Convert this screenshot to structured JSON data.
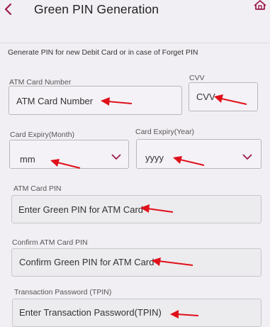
{
  "header": {
    "title": "Green PIN Generation",
    "back_icon": "chevron-left-icon",
    "home_icon": "home-icon"
  },
  "form": {
    "intro": "Generate PIN for new Debit Card or in case of Forget PIN",
    "card_number": {
      "label": "ATM Card Number",
      "placeholder": "ATM Card Number"
    },
    "cvv": {
      "label": "CVV",
      "placeholder": "CVV"
    },
    "expiry_month": {
      "label": "Card Expiry(Month)",
      "value": "mm"
    },
    "expiry_year": {
      "label": "Card Expiry(Year)",
      "value": "yyyy"
    },
    "atm_pin": {
      "label": "ATM Card PIN",
      "placeholder": "Enter Green PIN for ATM Card"
    },
    "confirm_pin": {
      "label": "Confirm ATM Card PIN",
      "placeholder": "Confirm Green PIN for ATM Card"
    },
    "tpin": {
      "label": "Transaction Password (TPIN)",
      "placeholder": "Enter Transaction Password(TPIN)"
    }
  },
  "colors": {
    "accent": "#9b1c4a",
    "annotation_arrow": "#e0101a"
  }
}
